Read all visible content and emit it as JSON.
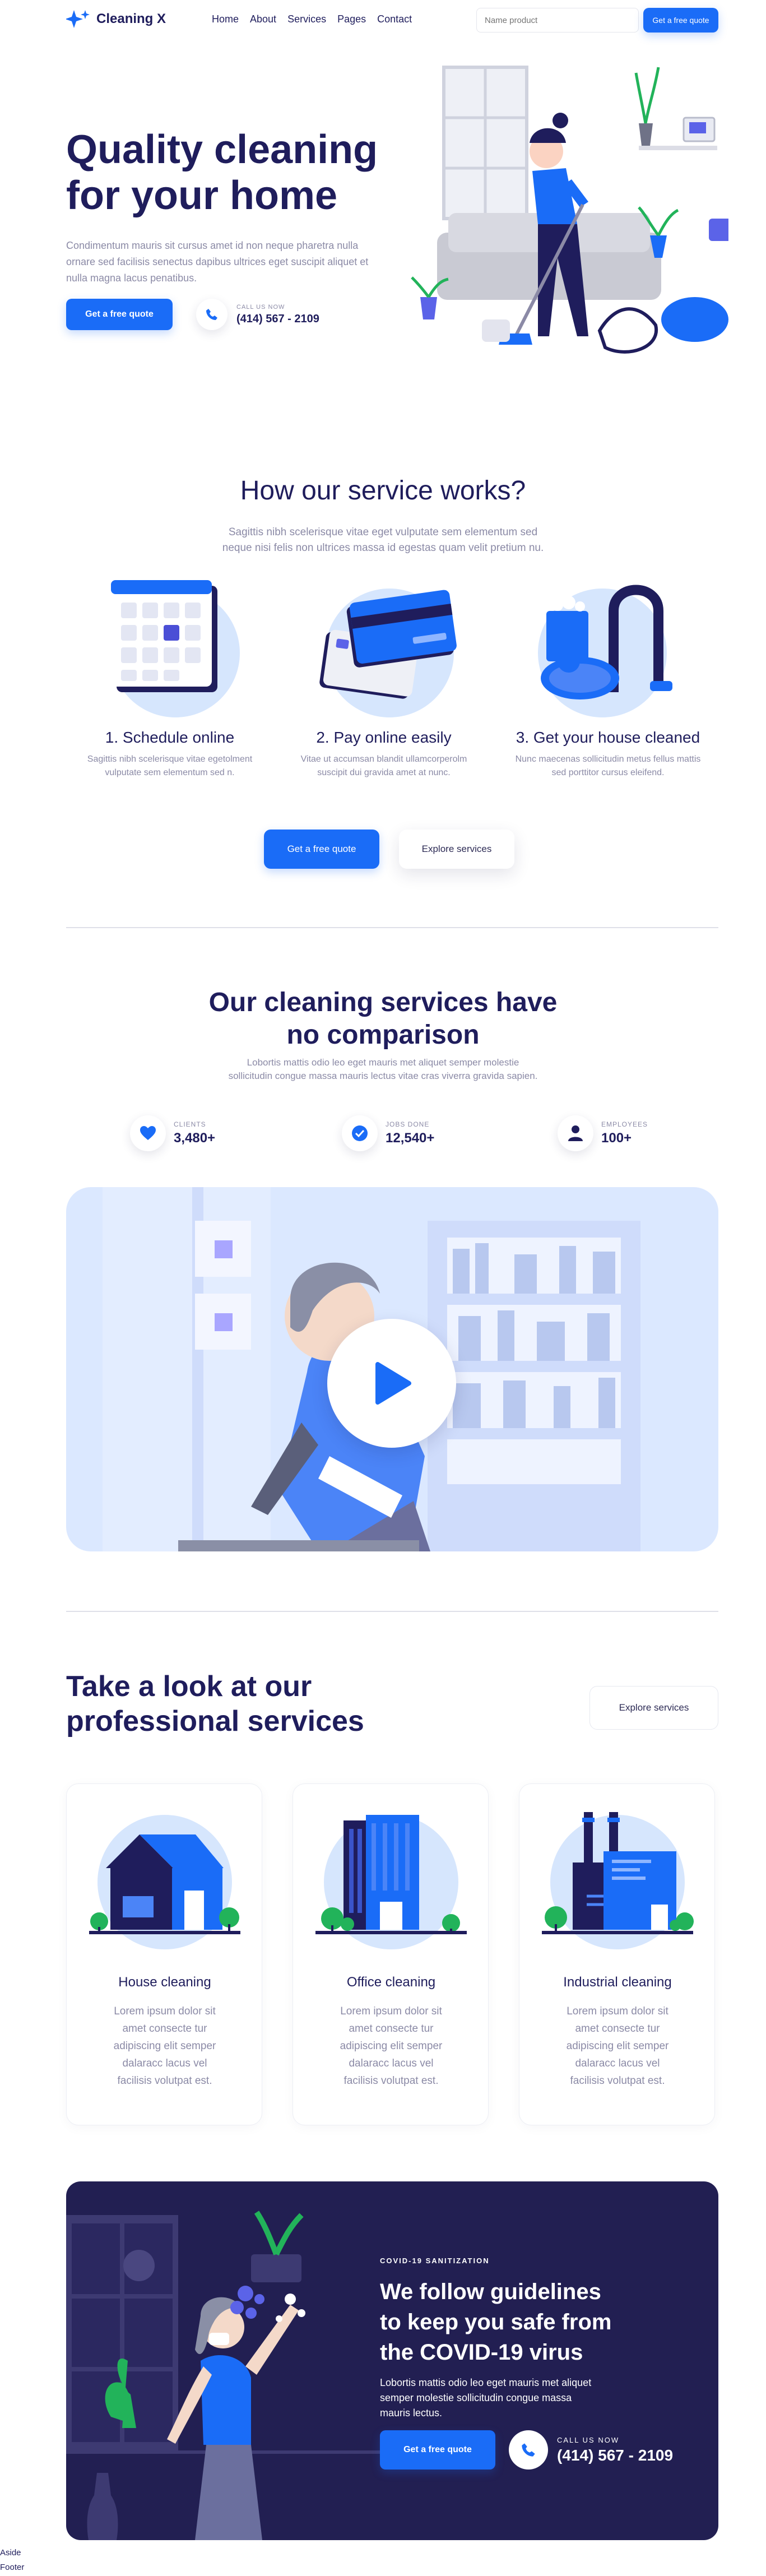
{
  "header": {
    "logo_text": "Cleaning X",
    "nav": [
      "Home",
      "About",
      "Services",
      "Pages",
      "Contact"
    ],
    "search_placeholder": "Name product",
    "cta": "Get a free quote"
  },
  "hero": {
    "title_line1": "Quality cleaning",
    "title_line2": "for your home",
    "body": "Condimentum mauris sit cursus amet id non neque pharetra nulla ornare sed facilisis senectus dapibus ultrices eget suscipit aliquet et nulla magna lacus penatibus.",
    "cta": "Get a free quote",
    "call_label": "CALL US NOW",
    "phone": "(414) 567 - 2109"
  },
  "how": {
    "title": "How our service works?",
    "subtitle_line1": "Sagittis nibh scelerisque vitae eget vulputate sem elementum sed",
    "subtitle_line2": "neque nisi felis non ultrices massa id egestas quam velit pretium nu.",
    "steps": [
      {
        "title": "1. Schedule online",
        "line1": "Sagittis nibh scelerisque vitae egetolment",
        "line2": "vulputate sem elementum sed n."
      },
      {
        "title": "2. Pay online easily",
        "line1": "Vitae ut accumsan blandit ullamcorperolm",
        "line2": "suscipit dui gravida amet at nunc."
      },
      {
        "title": "3. Get your house cleaned",
        "line1": "Nunc maecenas sollicitudin metus fellus mattis",
        "line2": "sed porttitor cursus eleifend."
      }
    ],
    "cta_primary": "Get a free quote",
    "cta_secondary": "Explore services"
  },
  "comparison": {
    "title_line1": "Our cleaning services have",
    "title_line2": "no comparison",
    "subtitle_line1": "Lobortis mattis odio leo eget mauris met aliquet semper molestie",
    "subtitle_line2": "sollicitudin congue massa mauris lectus vitae cras viverra gravida sapien.",
    "stats": [
      {
        "label": "CLIENTS",
        "value": "3,480+",
        "icon": "heart-icon"
      },
      {
        "label": "JOBS DONE",
        "value": "12,540+",
        "icon": "check-icon"
      },
      {
        "label": "EMPLOYEES",
        "value": "100+",
        "icon": "user-icon"
      }
    ]
  },
  "services": {
    "title_line1": "Take a look at our",
    "title_line2": "professional services",
    "cta": "Explore services",
    "cards": [
      {
        "title": "House cleaning",
        "lines": [
          "Lorem ipsum dolor sit",
          "amet consecte tur",
          "adipiscing elit semper",
          "dalaracc lacus vel",
          "facilisis volutpat est."
        ]
      },
      {
        "title": "Office cleaning",
        "lines": [
          "Lorem ipsum dolor sit",
          "amet consecte tur",
          "adipiscing elit semper",
          "dalaracc lacus vel",
          "facilisis volutpat est."
        ]
      },
      {
        "title": "Industrial cleaning",
        "lines": [
          "Lorem ipsum dolor sit",
          "amet consecte tur",
          "adipiscing elit semper",
          "dalaracc lacus vel",
          "facilisis volutpat est."
        ]
      }
    ]
  },
  "covid": {
    "eyebrow": "COVID-19 SANITIZATION",
    "title_line1": "We follow guidelines",
    "title_line2": "to keep you safe from",
    "title_line3": "the COVID-19 virus",
    "body_line1": "Lobortis mattis odio leo eget mauris met aliquet",
    "body_line2": "semper molestie sollicitudin congue massa",
    "body_line3": "mauris lectus.",
    "cta": "Get a free quote",
    "call_label": "CALL US NOW",
    "phone": "(414) 567 - 2109"
  },
  "footer": {
    "aside": "Aside",
    "footer": "Footer"
  },
  "colors": {
    "navy": "#1f1d5c",
    "blue": "#1a6cf7",
    "light_blue": "#d6e6fd",
    "dark_panel": "#221f52"
  }
}
